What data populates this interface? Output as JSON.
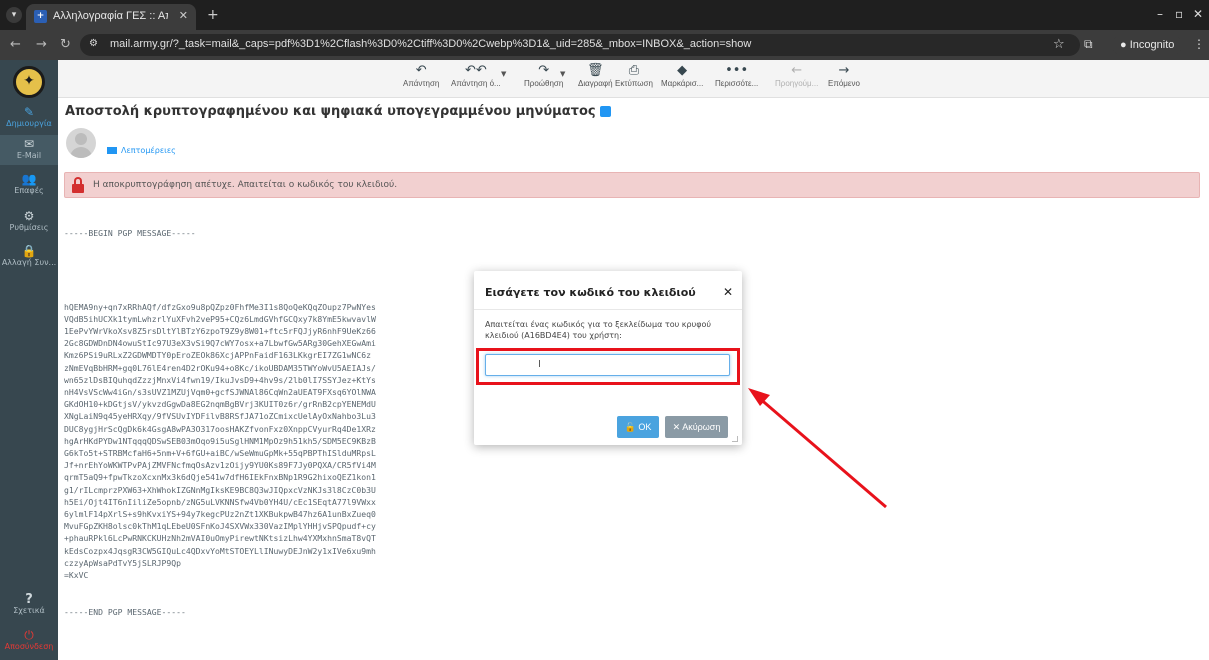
{
  "browser": {
    "tab_title": "Αλληλογραφία ΓΕΣ :: Απο",
    "url": "mail.army.gr/?_task=mail&_caps=pdf%3D1%2Cflash%3D0%2Ctiff%3D0%2Cwebp%3D1&_uid=285&_mbox=INBOX&_action=show",
    "incognito_label": "Incognito"
  },
  "sidebar": {
    "items": [
      {
        "label": "Δημιουργία",
        "icon": "compose-icon"
      },
      {
        "label": "E-Mail",
        "icon": "envelope-icon"
      },
      {
        "label": "Επαφές",
        "icon": "contacts-icon"
      },
      {
        "label": "Ρυθμίσεις",
        "icon": "gear-icon"
      },
      {
        "label": "Αλλαγή Συν...",
        "icon": "lock-icon"
      }
    ],
    "bottom": [
      {
        "label": "Σχετικά",
        "icon": "question-icon"
      },
      {
        "label": "Αποσύνδεση",
        "icon": "power-icon"
      }
    ]
  },
  "toolbar": {
    "reply": "Απάντηση",
    "reply_all": "Απάντηση ό...",
    "forward": "Προώθηση",
    "delete": "Διαγραφή",
    "print": "Εκτύπωση",
    "mark": "Μαρκάρισ...",
    "more": "Περισσότε...",
    "previous": "Προηγούμ...",
    "next": "Επόμενο"
  },
  "message": {
    "subject": "Αποστολή κρυπτογραφημένου και ψηφιακά υπογεγραμμένου μηνύματος",
    "details_link": "Λεπτομέρειες",
    "alert_text": "Η αποκρυπτογράφηση απέτυχε. Απαιτείται ο κωδικός του κλειδιού.",
    "pgp_begin": "-----BEGIN PGP MESSAGE-----",
    "pgp_lines": [
      "hQEMA9ny+qn7xRRhAQf/dfzGxo9u8pQZpz0FhfMe3I1s8QoQeKQqZOupz7PwNYes",
      "VQdB5ihUCXk1tymLwhzrlYuXFvh2veP95+CQz6LmdGVhfGCQxy7k8YmE5kwvavlW",
      "1EePvYWrVkoXsv8Z5rsDltYlBTzY6zpoT9Z9y8W01+ftc5rFQJjyR6nhF9UeKz66",
      "2Gc8GDWDnDN4owuStIc97U3eX3vSi9Q7cWY7osx+a7LbwfGw5ARg30GehXEGwAmi",
      "Kmz6PSi9uRLxZ2GDWMDTY0pEroZEOk86XcjAPPnFaidF163LKkgrEI7ZG1wNC6z",
      "zNmEVqBbHRM+gq0L76lE4ren4D2rOKu94+o8Kc/ikoUBDAM35TWYoWvU5AEIAJs/",
      "wn65zlDsBIQuhqdZzzjMnxVi4fwn19/IkuJvsD9+4hv9s/2lb0lI7SSYJez+KtYs",
      "nH4VsVScWw4iGn/s3sUVZ1MZUjVqm0+gcfSJWNAl86CqWn2aUEAT9FXsq6YOlNWA",
      "GKdOH10+kDGtjsV/ykvzdGgwDa8EG2nqmBgBVrj3KUIT0z6r/grRnB2cpYENEMdU",
      "XNgLaiN9q45yeHRXqy/9fVSUvIYDFilvB8RSfJA71oZCmixcUelAyOxNahbo3Lu3",
      "DUC8ygjHrScQgDk6k4GsgA8wPA3O317oosHAKZfvonFxz0XnppCVyurRq4De1XRz",
      "hgArHKdPYDw1NTqqqQDSwSEB03mOqo9i5uSglHNM1MpOz9h51kh5/SDM5EC9KBzB",
      "G6kTo5t+STRBMcfaH6+5nm+V+6fGU+aiBC/wSeWmuGpMk+55qPBPThISlduMRpsL",
      "Jf+nrEhYoWKWTPvPAjZMVFNcfmqOsAzv1zOijy9YU0Ks89F7Jy0PQXA/CR5fVi4M",
      "qrmT5aQ9+fpwTkzoXcxnMx3k6dQje541w7dfH6IEkFnxBNp1R9G2hixoQEZ1kon1",
      "g1/rILcmprzPXW63+XhWhokIZGNnMgIksKE9BC8Q3wJIQpxcVzNKJs3l8CzC0b3U",
      "h5Ei/Ojt4IT6nIiliZe5opnb/zNG5uLVKNNSfw4Vb0YH4U/cEc1SEqtA77l9VWxx",
      "6ylmlF14pXrlS+s9hKvxiYS+94y7kegcPUz2nZt1XKBukpwB47hz6A1unBxZueq0",
      "MvuFGpZKH8olsc0kThM1qLEbeU0SFnKoJ4SXVWx330VazIMplYHHjvSPQpudf+cy",
      "+phauRPkl6LcPwRNKCKUHzNh2mVAI0uOmyPirewtNKtsizLhw4YXMxhnSmaT8vQT",
      "kEdsCozpx4JqsgR3CW5GIQuLc4QDxvYoMtSTOEYLlINuwyDEJnW2y1xIVe6xu9mh",
      "czzyApWsaPdTvY5jSLRJP9Qp",
      "=KxVC"
    ],
    "pgp_end": "-----END PGP MESSAGE-----"
  },
  "dialog": {
    "title": "Εισάγετε τον κωδικό του κλειδιού",
    "text": "Απαιτείται ένας κωδικός για το ξεκλείδωμα του κρυφού κλειδιού (A16BD4E4) του χρήστη:",
    "input_value": "",
    "ok_label": "OK",
    "cancel_label": "Ακύρωση"
  },
  "colors": {
    "sidebar_bg": "#37474f",
    "accent": "#4aa3df",
    "alert_bg": "#f2d0d0",
    "annotation_red": "#e8121b"
  }
}
